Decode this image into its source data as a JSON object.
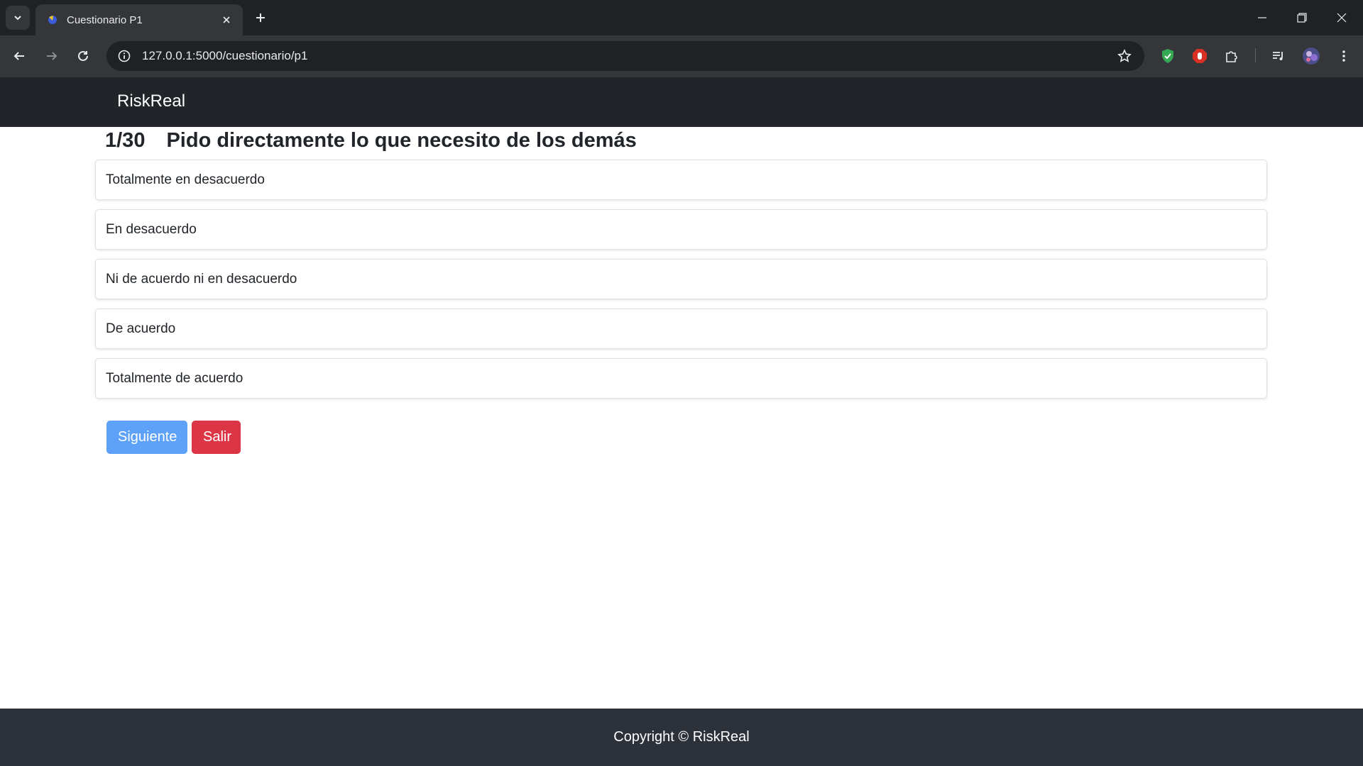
{
  "browser": {
    "tab_title": "Cuestionario P1",
    "url": "127.0.0.1:5000/cuestionario/p1",
    "icons": {
      "tab_search": "chevron-down-icon",
      "tab_close": "close-icon",
      "new_tab": "plus-icon",
      "back": "arrow-left-icon",
      "forward": "arrow-right-icon",
      "reload": "reload-icon",
      "site_info": "info-icon",
      "bookmark": "star-icon",
      "extensions": [
        "shield-extension-icon",
        "stop-hand-extension-icon",
        "puzzle-extensions-icon",
        "media-control-icon",
        "profile-avatar-icon",
        "kebab-menu-icon"
      ]
    }
  },
  "app": {
    "brand": "RiskReal"
  },
  "question": {
    "number": "1/30",
    "text": "Pido directamente lo que necesito de los demás"
  },
  "options": [
    {
      "label": "Totalmente en desacuerdo"
    },
    {
      "label": "En desacuerdo"
    },
    {
      "label": "Ni de acuerdo ni en desacuerdo"
    },
    {
      "label": "De acuerdo"
    },
    {
      "label": "Totalmente de acuerdo"
    }
  ],
  "actions": {
    "next_label": "Siguiente",
    "exit_label": "Salir"
  },
  "footer": {
    "text": "Copyright © RiskReal"
  },
  "colors": {
    "navbar": "#212529",
    "footer": "#2c313a",
    "primary_button": "#5ea1f8",
    "danger_button": "#dc3545"
  }
}
